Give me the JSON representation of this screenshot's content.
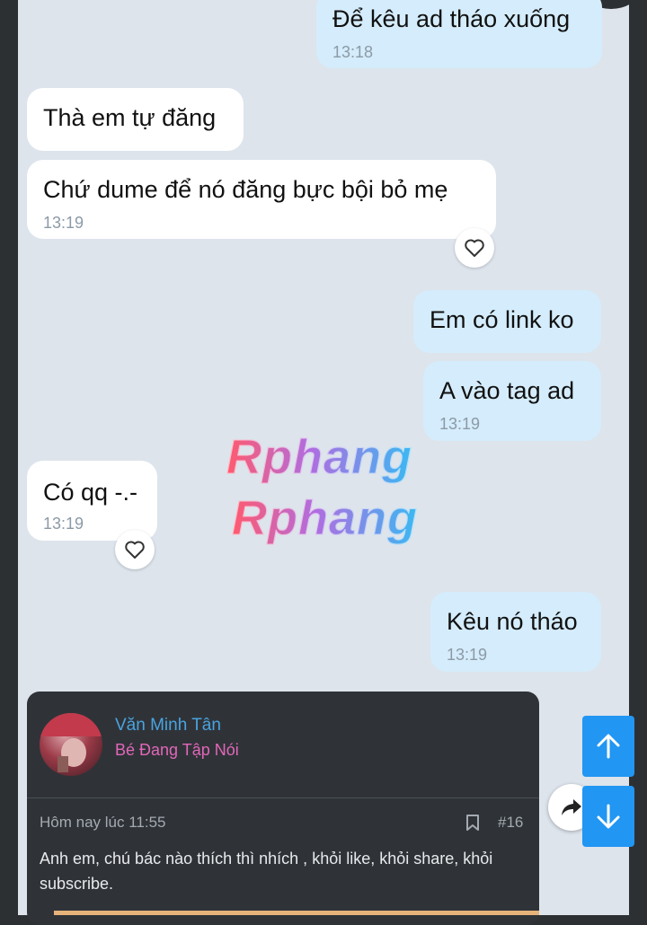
{
  "messages": [
    {
      "text": "Để kêu ad tháo xuống",
      "time": "13:18"
    },
    {
      "text": "Thà em tự đăng",
      "time": ""
    },
    {
      "text": "Chứ dume để nó đăng bực bội bỏ mẹ",
      "time": "13:19"
    },
    {
      "text": "Em có link ko",
      "time": ""
    },
    {
      "text": "A vào tag ad",
      "time": "13:19"
    },
    {
      "text": "Có qq -.-",
      "time": "13:19"
    },
    {
      "text": "Kêu nó tháo",
      "time": "13:19"
    }
  ],
  "watermark": {
    "line1": "Rphang",
    "line2": "Rphang"
  },
  "post": {
    "username": "Văn Minh Tân",
    "user_title": "Bé Đang Tập Nói",
    "timestamp": "Hôm nay lúc 11:55",
    "number": "#16",
    "body": "Anh em, chú bác nào thích thì nhích , khỏi like, khỏi share, khỏi subscribe."
  },
  "colors": {
    "incoming_bubble": "#ffffff",
    "outgoing_bubble": "#d4ecfb",
    "chat_background": "#dde4ec",
    "username": "#4aa3df",
    "user_title": "#e267b8",
    "nav_button": "#2196f3"
  },
  "icons": [
    "heart-icon",
    "bookmark-icon",
    "share-icon",
    "arrow-up-icon",
    "arrow-down-icon"
  ]
}
